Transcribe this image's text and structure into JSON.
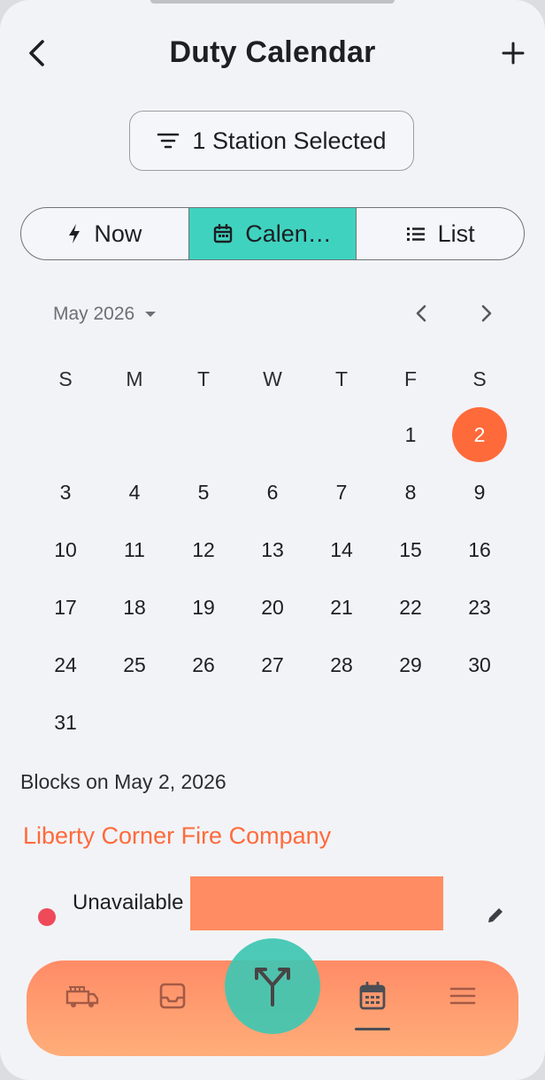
{
  "header": {
    "title": "Duty Calendar"
  },
  "filter": {
    "station_label": "1 Station Selected"
  },
  "view_tabs": [
    {
      "label": "Now",
      "icon": "bolt-icon"
    },
    {
      "label": "Calen…",
      "icon": "calendar-icon",
      "active": true
    },
    {
      "label": "List",
      "icon": "list-icon"
    }
  ],
  "calendar": {
    "month_label": "May 2026",
    "weekdays": [
      "S",
      "M",
      "T",
      "W",
      "T",
      "F",
      "S"
    ],
    "weeks": [
      [
        "",
        "",
        "",
        "",
        "",
        "1",
        "2"
      ],
      [
        "3",
        "4",
        "5",
        "6",
        "7",
        "8",
        "9"
      ],
      [
        "10",
        "11",
        "12",
        "13",
        "14",
        "15",
        "16"
      ],
      [
        "17",
        "18",
        "19",
        "20",
        "21",
        "22",
        "23"
      ],
      [
        "24",
        "25",
        "26",
        "27",
        "28",
        "29",
        "30"
      ],
      [
        "31",
        "",
        "",
        "",
        "",
        "",
        ""
      ]
    ],
    "selected_day": "2"
  },
  "blocks": {
    "heading": "Blocks on May 2, 2026",
    "station": "Liberty Corner Fire Company",
    "items": [
      {
        "status": "Unavailable"
      }
    ]
  },
  "colors": {
    "accent_teal": "#3fd3bf",
    "accent_orange": "#ff6a3a",
    "unavailable_red": "#ef4a5a"
  },
  "nav": {
    "items": [
      "fire-truck-icon",
      "inbox-icon",
      "calendar-icon",
      "menu-icon"
    ],
    "fab_icon": "split-arrows-icon",
    "active": "calendar-icon"
  }
}
